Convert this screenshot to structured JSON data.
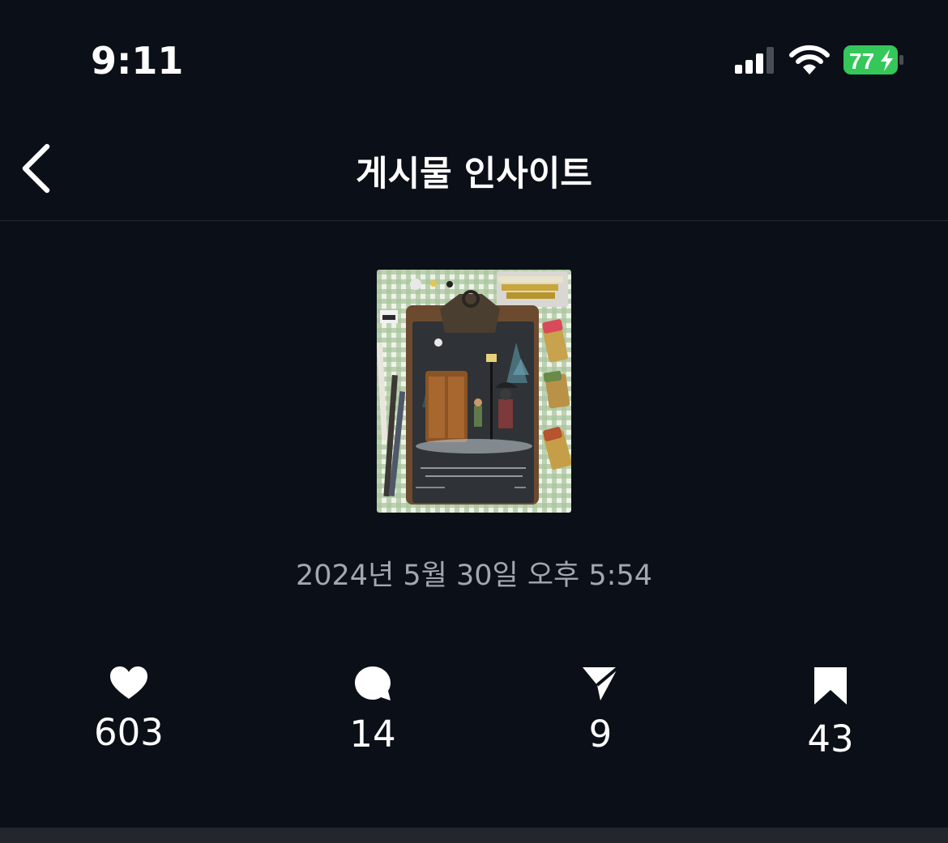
{
  "status_bar": {
    "time": "9:11",
    "battery_level": "77",
    "battery_charging": true,
    "signal_bars": 3,
    "battery_color": "#34c759"
  },
  "header": {
    "title": "게시물 인사이트",
    "back_icon": "chevron-left-icon"
  },
  "post": {
    "date": "2024년 5월 30일 오후 5:54"
  },
  "metrics": [
    {
      "icon": "heart-icon",
      "value": "603"
    },
    {
      "icon": "comment-icon",
      "value": "14"
    },
    {
      "icon": "share-icon",
      "value": "9"
    },
    {
      "icon": "bookmark-icon",
      "value": "43"
    }
  ],
  "colors": {
    "background": "#0b0f17",
    "secondary_text": "#a2a7b1"
  }
}
